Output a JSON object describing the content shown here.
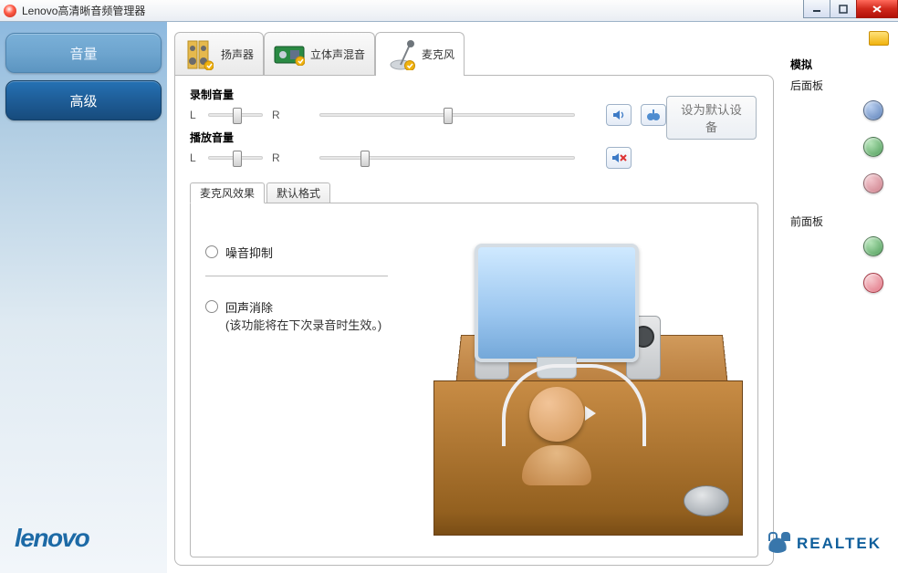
{
  "window": {
    "title": "Lenovo高清晰音频管理器"
  },
  "sidebar": {
    "items": [
      {
        "label": "音量"
      },
      {
        "label": "高级"
      }
    ],
    "logo": "lenovo"
  },
  "device_tabs": [
    {
      "label": "扬声器"
    },
    {
      "label": "立体声混音"
    },
    {
      "label": "麦克风"
    }
  ],
  "volumes": {
    "recording": {
      "title": "录制音量",
      "l_label": "L",
      "r_label": "R"
    },
    "playback": {
      "title": "播放音量",
      "l_label": "L",
      "r_label": "R"
    }
  },
  "set_default_button": "设为默认设备",
  "sub_tabs": [
    {
      "label": "麦克风效果"
    },
    {
      "label": "默认格式"
    }
  ],
  "mic_effects": {
    "options": [
      {
        "label": "噪音抑制"
      },
      {
        "label": "回声消除",
        "note": "(该功能将在下次录音时生效。)"
      }
    ]
  },
  "right_panel": {
    "section_title": "模拟",
    "rear_label": "后面板",
    "front_label": "前面板"
  },
  "footer": {
    "realtek": "REALTEK"
  }
}
